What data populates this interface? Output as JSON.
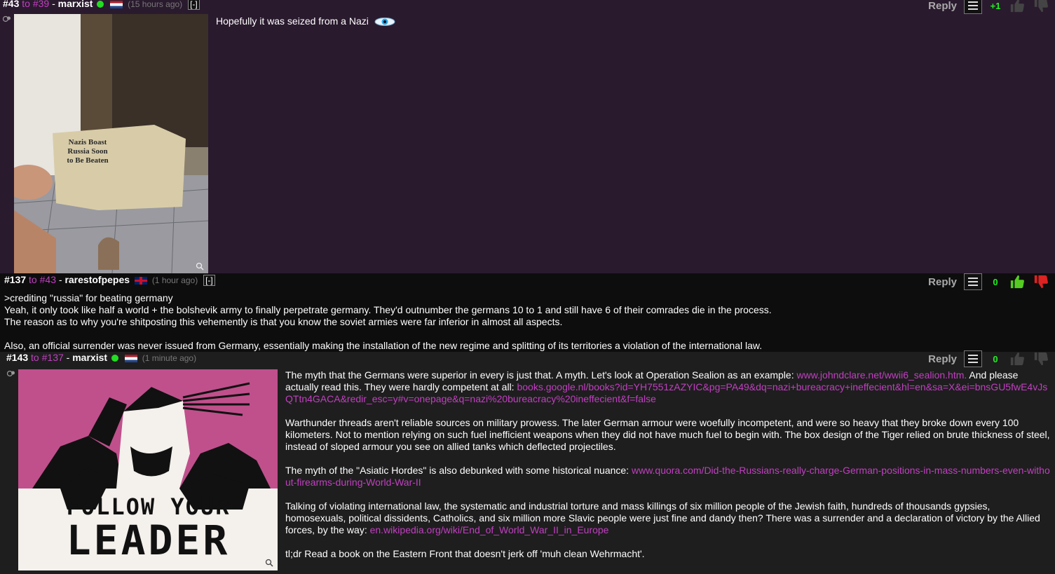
{
  "reply_label": "Reply",
  "collapse_label": "[-]",
  "comments": [
    {
      "num": "#43",
      "to_prefix": "to",
      "to": "#39",
      "sep": "-",
      "username": "marxist",
      "time": "(15 hours ago)",
      "score": "+1",
      "text": "Hopefully it was seized from a Nazi",
      "image_text": [
        "Nazis Boast",
        "Russia Soon",
        "to Be Beaten"
      ]
    },
    {
      "num": "#137",
      "to_prefix": "to",
      "to": "#43",
      "sep": "-",
      "username": "rarestofpepes",
      "time": "(1 hour ago)",
      "score": "0",
      "lines": [
        ">crediting \"russia\" for beating germany",
        "Yeah, it only took like half a world + the bolshevik army to finally perpetrate germany. They'd outnumber the germans 10 to 1 and still have 6 of their comrades die in the process.",
        "The reason as to why you're shitposting this vehemently is that you know the soviet armies were far inferior in almost all aspects.",
        "Also, an official surrender was never issued from Germany, essentially making the installation of the new regime and splitting of its territories a violation of the international law."
      ]
    },
    {
      "num": "#143",
      "to_prefix": "to",
      "to": "#137",
      "sep": "-",
      "username": "marxist",
      "time": "(1 minute ago)",
      "score": "0",
      "image_text": [
        "FOLLOW YOUR",
        "LEADER"
      ],
      "p1_a": "The myth that the Germans were superior in every is just that. A myth. Let's look at Operation Sealion as an example: ",
      "p1_link1": "www.johndclare.net/wwii6_sealion.htm.",
      "p1_b": " And please actually read this. They were hardly competent at all: ",
      "p1_link2": "books.google.nl/books?id=YH7551zAZYIC&pg=PA49&dq=nazi+bureacracy+ineffecient&hl=en&sa=X&ei=bnsGU5fwE4vJsQTtn4GACA&redir_esc=y#v=onepage&q=nazi%20bureacracy%20ineffecient&f=false",
      "p2": "Warthunder threads aren't reliable sources on military prowess. The later German armour were woefully incompetent, and were so heavy that they broke down every 100 kilometers. Not to mention relying on such fuel inefficient weapons when they did not have much fuel to begin with. The box design of the Tiger relied on brute thickness of steel, instead of sloped armour you see on allied tanks which deflected projectiles.",
      "p3_a": "The myth of the \"Asiatic Hordes\" is also debunked with some historical nuance: ",
      "p3_link": "www.quora.com/Did-the-Russians-really-charge-German-positions-in-mass-numbers-even-without-firearms-during-World-War-II",
      "p4_a": "Talking of violating international law, the systematic and industrial torture and mass killings of six million people of the Jewish faith, hundreds of thousands gypsies, homosexuals, political dissidents, Catholics, and six million more Slavic people were just fine and dandy then? There was a surrender and a declaration of victory by the Allied forces, by the way: ",
      "p4_link": "en.wikipedia.org/wiki/End_of_World_War_II_in_Europe",
      "p5": "tl;dr Read a book on the Eastern Front that doesn't jerk off 'muh clean Wehrmacht'."
    }
  ]
}
